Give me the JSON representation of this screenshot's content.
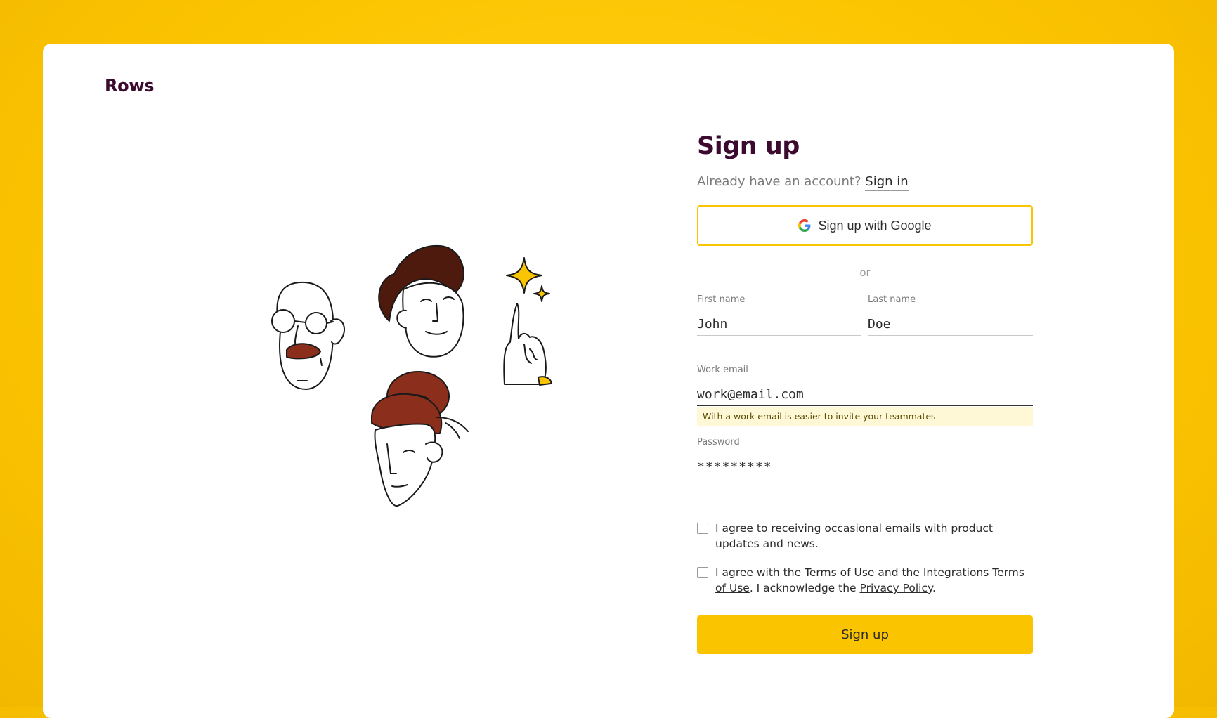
{
  "brand": {
    "logo_text": "Rows",
    "accent": "#FBC400",
    "title_color": "#3B0A2E"
  },
  "form": {
    "title": "Sign up",
    "already_text": "Already have an account?",
    "signin_link": "Sign in",
    "google_button": "Sign up with Google",
    "divider_text": "or",
    "first_name": {
      "label": "First name",
      "value": "John"
    },
    "last_name": {
      "label": "Last name",
      "value": "Doe"
    },
    "email": {
      "label": "Work email",
      "value": "work@email.com",
      "hint": "With a work email is easier to invite your teammates"
    },
    "password": {
      "label": "Password",
      "value": "*********"
    },
    "consent_emails": "I agree to receiving occasional emails with product updates and news.",
    "consent_terms": {
      "prefix": "I agree with the ",
      "terms_link": "Terms of Use",
      "middle": " and the ",
      "integrations_link": "Integrations Terms of Use",
      "after": ". I acknowledge the ",
      "privacy_link": "Privacy Policy",
      "end": "."
    },
    "submit": "Sign up"
  }
}
